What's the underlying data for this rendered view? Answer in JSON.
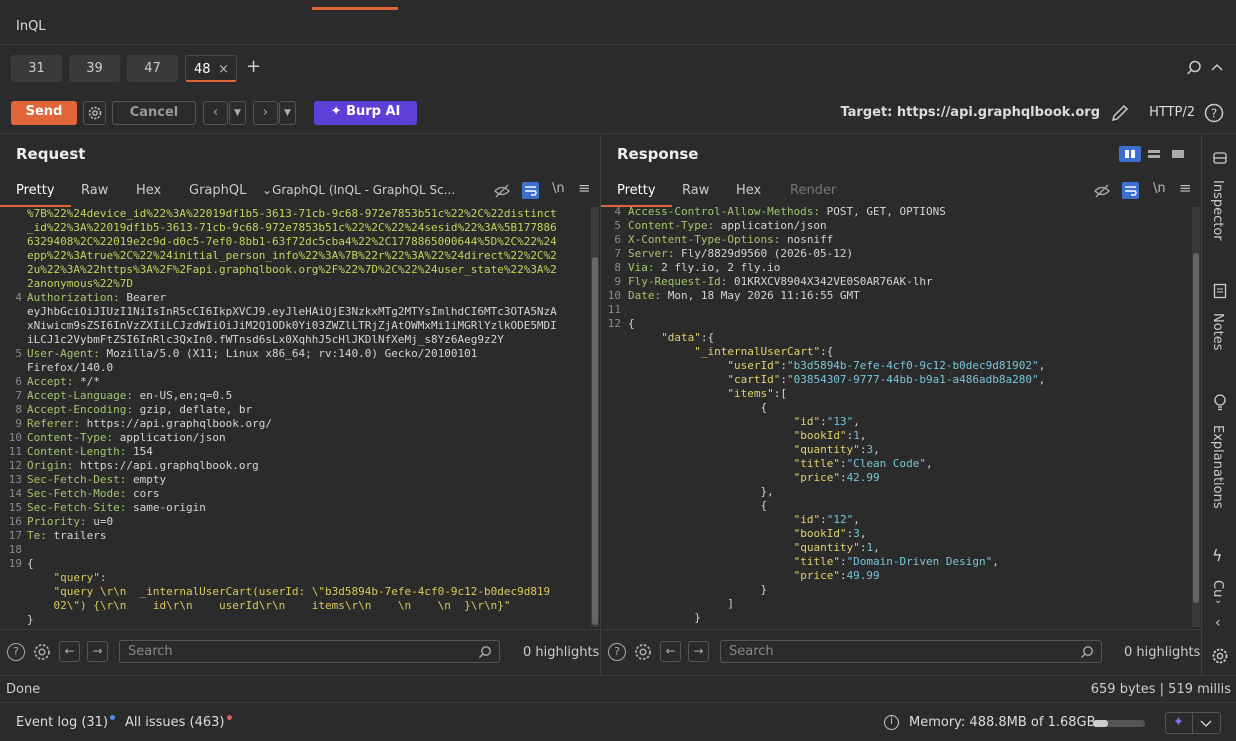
{
  "window": {
    "title": "InQL"
  },
  "request_tabs": [
    {
      "label": "31"
    },
    {
      "label": "39"
    },
    {
      "label": "47"
    },
    {
      "label": "48"
    }
  ],
  "toolbar": {
    "send": "Send",
    "cancel": "Cancel",
    "burp_ai": "Burp AI",
    "target": "Target: https://api.graphqlbook.org",
    "http_version": "HTTP/2"
  },
  "request": {
    "title": "Request",
    "tabs": [
      "Pretty",
      "Raw",
      "Hex",
      "GraphQL",
      "GraphQL (InQL - GraphQL Sc..."
    ],
    "lines": [
      {
        "n": "",
        "t": "%7B%22%24device_id%22%3A%22019df1b5-3613-71cb-9c68-972e7853b51c%22%2C%22distinct"
      },
      {
        "n": "",
        "t": "_id%22%3A%22019df1b5-3613-71cb-9c68-972e7853b51c%22%2C%22%24sesid%22%3A%5B177886"
      },
      {
        "n": "",
        "t": "6329408%2C%22019e2c9d-d0c5-7ef0-8bb1-63f72dc5cba4%22%2C1778865000644%5D%2C%22%24"
      },
      {
        "n": "",
        "t": "epp%22%3Atrue%2C%22%24initial_person_info%22%3A%7B%22r%22%3A%22%24direct%22%2C%2"
      },
      {
        "n": "",
        "t": "2u%22%3A%22https%3A%2F%2Fapi.graphqlbook.org%2F%22%7D%2C%22%24user_state%22%3A%2"
      },
      {
        "n": "",
        "t": "2anonymous%22%7D"
      },
      {
        "n": "4",
        "t": "Authorization: Bearer"
      },
      {
        "n": "",
        "t": "eyJhbGciOiJIUzI1NiIsInR5cCI6IkpXVCJ9.eyJleHAiOjE3NzkxMTg2MTYsImlhdCI6MTc3OTA5NzA"
      },
      {
        "n": "",
        "t": "xNiwicm9sZSI6InVzZXIiLCJzdWIiOiJiM2Q1ODk0Yi03ZWZlLTRjZjAtOWMxMi1iMGRlYzlkODE5MDI"
      },
      {
        "n": "",
        "t": "iLCJ1c2VybmFtZSI6InRlc3QxIn0.fWTnsd6sLx0XqhhJ5cHlJKDlNfXeMj_s8Yz6Aeg9z2Y"
      },
      {
        "n": "5",
        "t": "User-Agent: Mozilla/5.0 (X11; Linux x86_64; rv:140.0) Gecko/20100101"
      },
      {
        "n": "",
        "t": "Firefox/140.0"
      },
      {
        "n": "6",
        "t": "Accept: */*"
      },
      {
        "n": "7",
        "t": "Accept-Language: en-US,en;q=0.5"
      },
      {
        "n": "8",
        "t": "Accept-Encoding: gzip, deflate, br"
      },
      {
        "n": "9",
        "t": "Referer: https://api.graphqlbook.org/"
      },
      {
        "n": "10",
        "t": "Content-Type: application/json"
      },
      {
        "n": "11",
        "t": "Content-Length: 154"
      },
      {
        "n": "12",
        "t": "Origin: https://api.graphqlbook.org"
      },
      {
        "n": "13",
        "t": "Sec-Fetch-Dest: empty"
      },
      {
        "n": "14",
        "t": "Sec-Fetch-Mode: cors"
      },
      {
        "n": "15",
        "t": "Sec-Fetch-Site: same-origin"
      },
      {
        "n": "16",
        "t": "Priority: u=0"
      },
      {
        "n": "17",
        "t": "Te: trailers"
      },
      {
        "n": "18",
        "t": ""
      },
      {
        "n": "19",
        "t": "{"
      },
      {
        "n": "",
        "t": "    \"query\":"
      },
      {
        "n": "",
        "t": "    \"query \\r\\n  _internalUserCart(userId: \\\"b3d5894b-7efe-4cf0-9c12-b0dec9d819"
      },
      {
        "n": "",
        "t": "    02\\\") {\\r\\n    id\\r\\n    userId\\r\\n    items\\r\\n    \\n    \\n  }\\r\\n}\""
      },
      {
        "n": "",
        "t": "}"
      }
    ],
    "search_placeholder": "Search",
    "highlights": "0 highlights"
  },
  "response": {
    "title": "Response",
    "tabs": [
      "Pretty",
      "Raw",
      "Hex",
      "Render"
    ],
    "lines": [
      {
        "n": "4",
        "t": "Access-Control-Allow-Methods: POST, GET, OPTIONS"
      },
      {
        "n": "5",
        "t": "Content-Type: application/json"
      },
      {
        "n": "6",
        "t": "X-Content-Type-Options: nosniff"
      },
      {
        "n": "7",
        "t": "Server: Fly/8829d9560 (2026-05-12)"
      },
      {
        "n": "8",
        "t": "Via: 2 fly.io, 2 fly.io"
      },
      {
        "n": "9",
        "t": "Fly-Request-Id: 01KRXCV8904X342VE0S0AR76AK-lhr"
      },
      {
        "n": "10",
        "t": "Date: Mon, 18 May 2026 11:16:55 GMT"
      },
      {
        "n": "11",
        "t": ""
      },
      {
        "n": "12",
        "t": "{"
      },
      {
        "n": "",
        "t": "     \"data\":{"
      },
      {
        "n": "",
        "t": "          \"_internalUserCart\":{"
      },
      {
        "n": "",
        "t": "               \"userId\":\"b3d5894b-7efe-4cf0-9c12-b0dec9d81902\","
      },
      {
        "n": "",
        "t": "               \"cartId\":\"03854307-9777-44bb-b9a1-a486adb8a280\","
      },
      {
        "n": "",
        "t": "               \"items\":["
      },
      {
        "n": "",
        "t": "                    {"
      },
      {
        "n": "",
        "t": "                         \"id\":\"13\","
      },
      {
        "n": "",
        "t": "                         \"bookId\":1,"
      },
      {
        "n": "",
        "t": "                         \"quantity\":3,"
      },
      {
        "n": "",
        "t": "                         \"title\":\"Clean Code\","
      },
      {
        "n": "",
        "t": "                         \"price\":42.99"
      },
      {
        "n": "",
        "t": "                    },"
      },
      {
        "n": "",
        "t": "                    {"
      },
      {
        "n": "",
        "t": "                         \"id\":\"12\","
      },
      {
        "n": "",
        "t": "                         \"bookId\":3,"
      },
      {
        "n": "",
        "t": "                         \"quantity\":1,"
      },
      {
        "n": "",
        "t": "                         \"title\":\"Domain-Driven Design\","
      },
      {
        "n": "",
        "t": "                         \"price\":49.99"
      },
      {
        "n": "",
        "t": "                    }"
      },
      {
        "n": "",
        "t": "               ]"
      },
      {
        "n": "",
        "t": "          }"
      }
    ],
    "search_placeholder": "Search",
    "highlights": "0 highlights"
  },
  "side_panel": [
    {
      "label": "Inspector"
    },
    {
      "label": "Notes"
    },
    {
      "label": "Explanations"
    },
    {
      "label": "Cu"
    }
  ],
  "status": {
    "left": "Done",
    "right": "659 bytes | 519 millis"
  },
  "footer": {
    "event_log": "Event log (31)",
    "all_issues": "All issues (463)",
    "memory": "Memory: 488.8MB of 1.68GB",
    "memory_fraction": 0.29,
    "colors": {
      "event_dot": "#4a90e2",
      "issues_dot": "#e05a5a",
      "accent": "#e0663a",
      "burp_ai": "#5b3fd6"
    }
  }
}
